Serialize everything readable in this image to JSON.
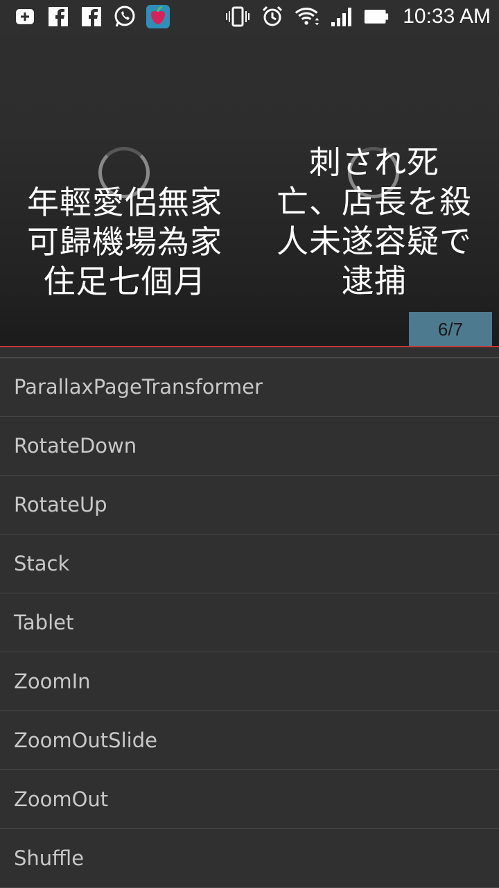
{
  "status_bar": {
    "time": "10:33 AM",
    "left_icons": [
      "add-box-icon",
      "facebook-icon",
      "facebook-icon",
      "whatsapp-icon",
      "app-icon"
    ],
    "right_icons": [
      "vibrate-icon",
      "alarm-icon",
      "wifi-icon",
      "signal-icon",
      "battery-icon"
    ]
  },
  "pager": {
    "left_headline": "年輕愛侶無家\n可歸機場為家\n住足七個月",
    "right_headline": "刺され死\n亡、店長を殺\n人未遂容疑で\n逮捕",
    "indicator": "6/7"
  },
  "list": {
    "items": [
      "ParallaxPageTransformer",
      "RotateDown",
      "RotateUp",
      "Stack",
      "Tablet",
      "ZoomIn",
      "ZoomOutSlide",
      "ZoomOut",
      "Shuffle"
    ]
  },
  "colors": {
    "background": "#303030",
    "indicator": "#4e7a8f",
    "accent_line": "#c0393b"
  }
}
